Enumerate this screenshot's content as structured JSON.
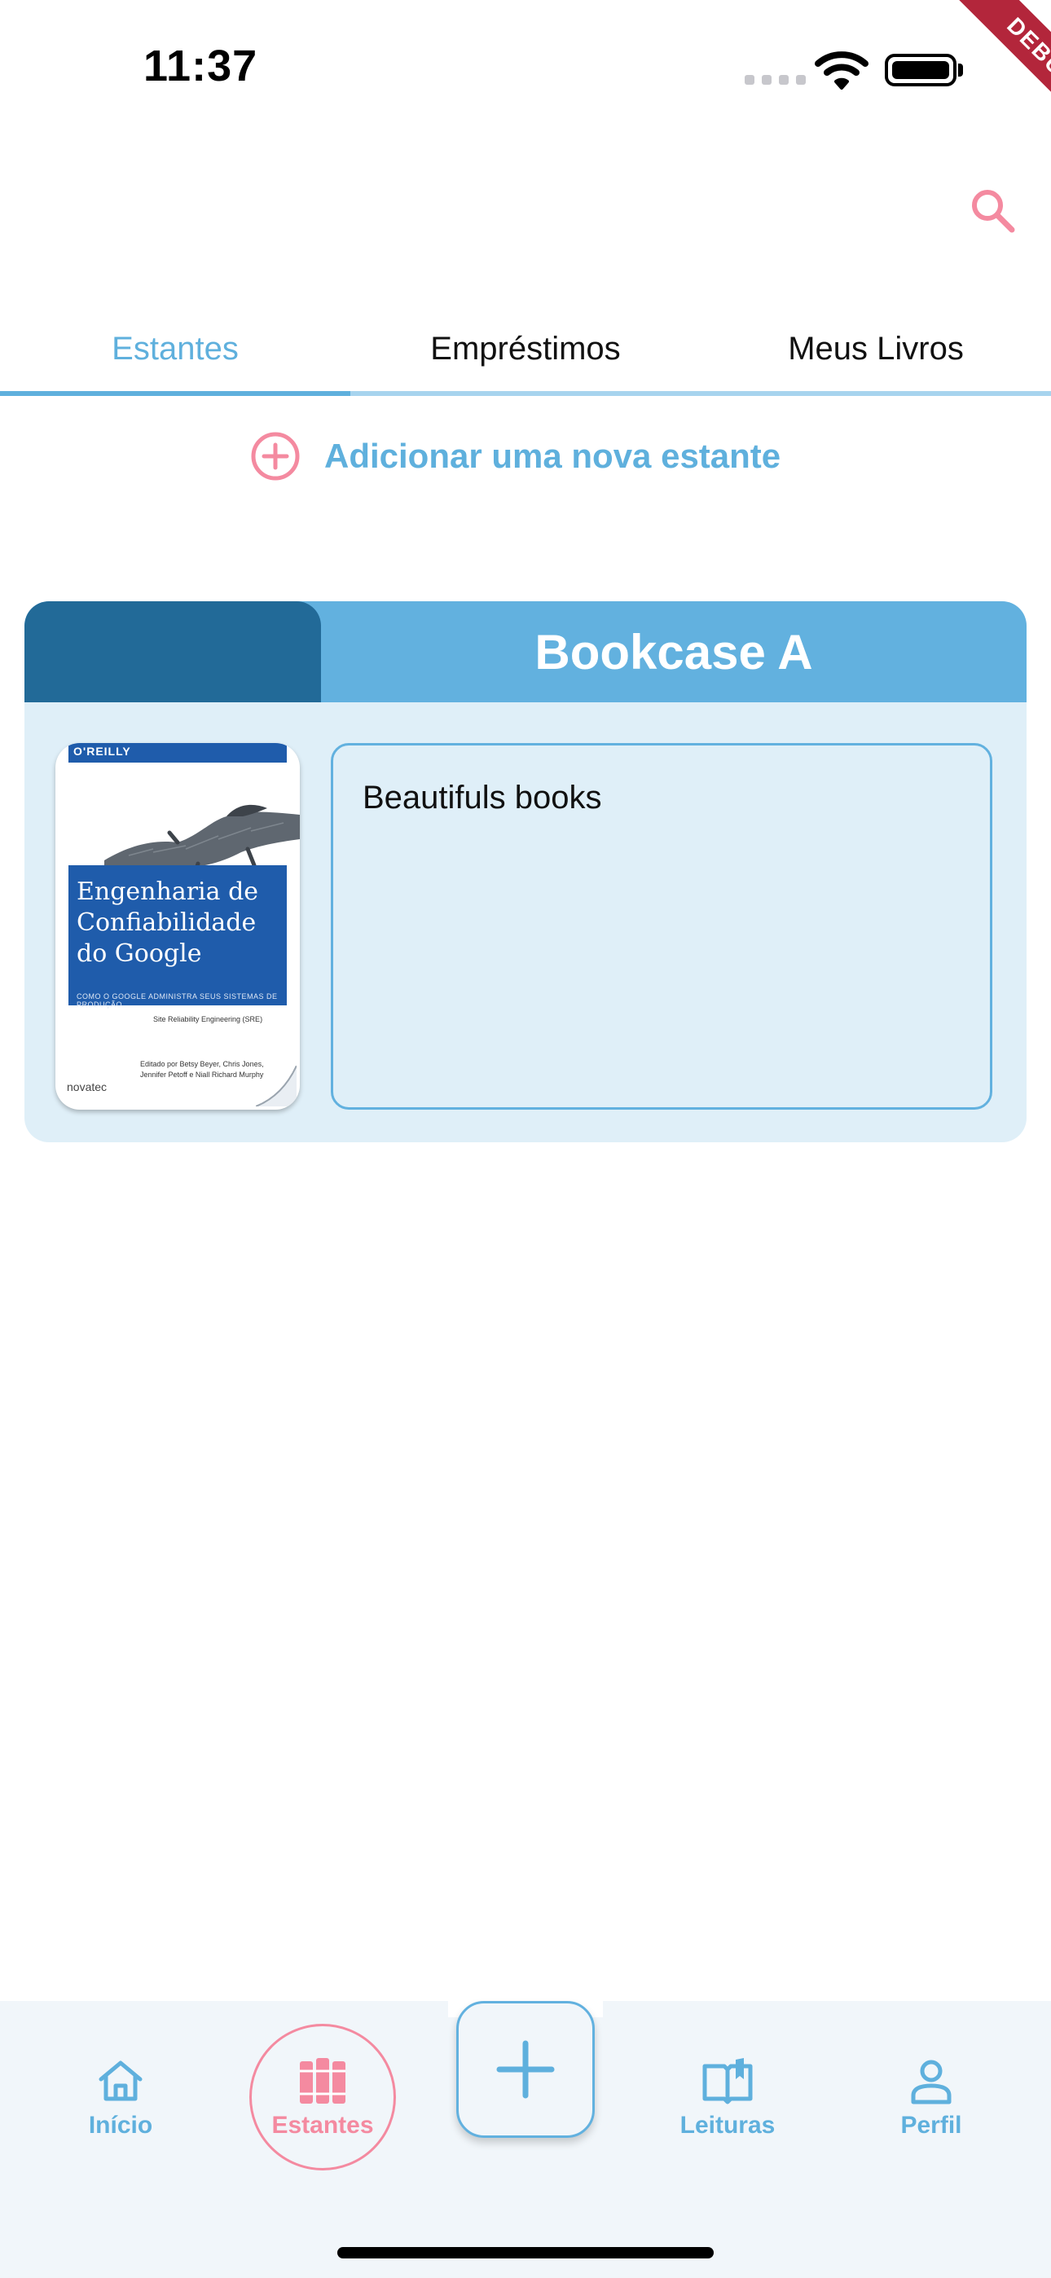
{
  "status_bar": {
    "time": "11:37"
  },
  "debug_ribbon": "DEBUG",
  "header": {
    "search_icon": "search-icon"
  },
  "tabs": [
    {
      "label": "Estantes",
      "active": true
    },
    {
      "label": "Empréstimos",
      "active": false
    },
    {
      "label": "Meus Livros",
      "active": false
    }
  ],
  "add_shelf": {
    "label": "Adicionar uma nova estante",
    "icon": "plus-circle-icon"
  },
  "bookcase": {
    "title": "Bookcase A",
    "description": "Beautifuls books",
    "book": {
      "brand": "O'REILLY",
      "title": "Engenharia de Confiabilidade do Google",
      "subtitle": "COMO O GOOGLE ADMINISTRA SEUS SISTEMAS DE PRODUÇÃO",
      "series": "Site Reliability Engineering (SRE)",
      "editors": "Editado por Betsy Beyer, Chris Jones, Jennifer Petoff e Niall Richard Murphy",
      "publisher": "novatec"
    }
  },
  "bottom_nav": {
    "items": [
      {
        "label": "Início",
        "icon": "home-icon"
      },
      {
        "label": "Estantes",
        "icon": "books-icon",
        "active": true
      },
      {
        "label": "Leituras",
        "icon": "open-book-icon"
      },
      {
        "label": "Perfil",
        "icon": "person-icon"
      }
    ],
    "fab_icon": "plus-icon"
  },
  "colors": {
    "accent_blue": "#5fb0dd",
    "dark_blue": "#226a98",
    "pink": "#f48aa0",
    "card_bg": "#dfeff8"
  }
}
